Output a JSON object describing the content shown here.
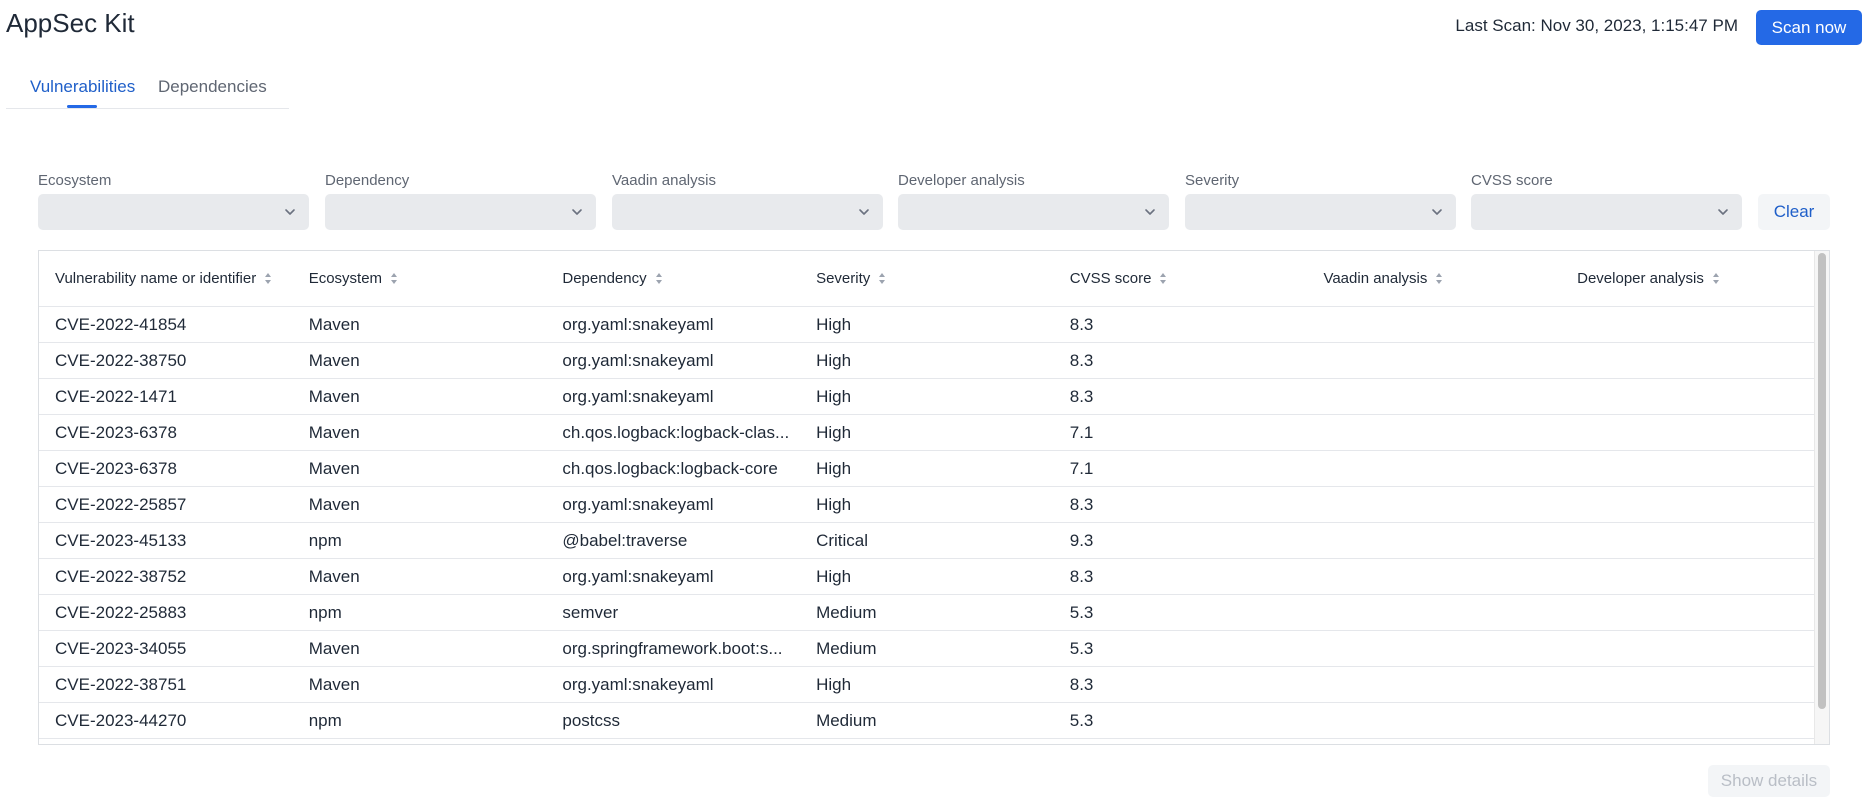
{
  "app": {
    "title": "AppSec Kit"
  },
  "header": {
    "last_scan": "Last Scan: Nov 30, 2023, 1:15:47 PM",
    "scan_button": "Scan now"
  },
  "tabs": [
    {
      "label": "Vulnerabilities",
      "active": true
    },
    {
      "label": "Dependencies",
      "active": false
    }
  ],
  "filters": [
    {
      "label": "Ecosystem",
      "value": ""
    },
    {
      "label": "Dependency",
      "value": ""
    },
    {
      "label": "Vaadin analysis",
      "value": ""
    },
    {
      "label": "Developer analysis",
      "value": ""
    },
    {
      "label": "Severity",
      "value": ""
    },
    {
      "label": "CVSS score",
      "value": ""
    }
  ],
  "clear_button": "Clear",
  "table": {
    "columns": [
      "Vulnerability name or identifier",
      "Ecosystem",
      "Dependency",
      "Severity",
      "CVSS score",
      "Vaadin analysis",
      "Developer analysis"
    ],
    "rows": [
      [
        "CVE-2022-41854",
        "Maven",
        "org.yaml:snakeyaml",
        "High",
        "8.3",
        "",
        ""
      ],
      [
        "CVE-2022-38750",
        "Maven",
        "org.yaml:snakeyaml",
        "High",
        "8.3",
        "",
        ""
      ],
      [
        "CVE-2022-1471",
        "Maven",
        "org.yaml:snakeyaml",
        "High",
        "8.3",
        "",
        ""
      ],
      [
        "CVE-2023-6378",
        "Maven",
        "ch.qos.logback:logback-clas...",
        "High",
        "7.1",
        "",
        ""
      ],
      [
        "CVE-2023-6378",
        "Maven",
        "ch.qos.logback:logback-core",
        "High",
        "7.1",
        "",
        ""
      ],
      [
        "CVE-2022-25857",
        "Maven",
        "org.yaml:snakeyaml",
        "High",
        "8.3",
        "",
        ""
      ],
      [
        "CVE-2023-45133",
        "npm",
        "@babel:traverse",
        "Critical",
        "9.3",
        "",
        ""
      ],
      [
        "CVE-2022-38752",
        "Maven",
        "org.yaml:snakeyaml",
        "High",
        "8.3",
        "",
        ""
      ],
      [
        "CVE-2022-25883",
        "npm",
        "semver",
        "Medium",
        "5.3",
        "",
        ""
      ],
      [
        "CVE-2023-34055",
        "Maven",
        "org.springframework.boot:s...",
        "Medium",
        "5.3",
        "",
        ""
      ],
      [
        "CVE-2022-38751",
        "Maven",
        "org.yaml:snakeyaml",
        "High",
        "8.3",
        "",
        ""
      ],
      [
        "CVE-2023-44270",
        "npm",
        "postcss",
        "Medium",
        "5.3",
        "",
        ""
      ]
    ]
  },
  "show_details_button": "Show details",
  "icons": {
    "filter_dropdown": "chevron-down-icon",
    "column_sort": "sort-icon"
  },
  "colors": {
    "accent": "#2469e6",
    "tab_active": "#1f5fc9",
    "field_bg": "#e8eaed",
    "text": "#1f2937",
    "muted": "#5f6672"
  }
}
